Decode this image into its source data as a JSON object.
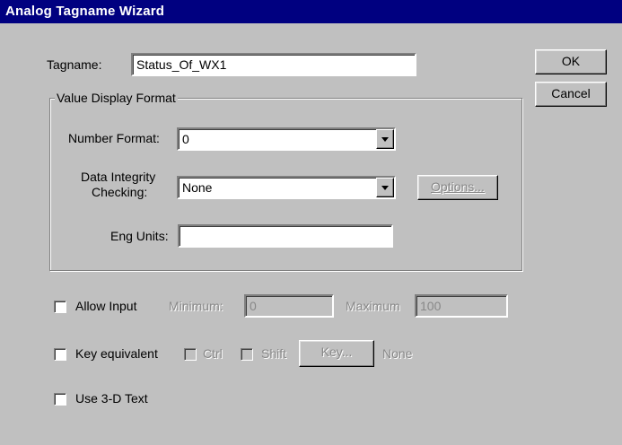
{
  "window": {
    "title": "Analog Tagname Wizard"
  },
  "tagname": {
    "label": "Tagname:",
    "value": "Status_Of_WX1"
  },
  "buttons": {
    "ok": "OK",
    "cancel": "Cancel",
    "options": "Options...",
    "key": "Key..."
  },
  "value_display": {
    "group_label": "Value Display Format",
    "number_format_label": "Number Format:",
    "number_format_value": "0",
    "integrity_label_line1": "Data Integrity",
    "integrity_label_line2": "Checking:",
    "integrity_value": "None",
    "eng_units_label": "Eng Units:",
    "eng_units_value": ""
  },
  "allow_input": {
    "label": "Allow Input",
    "checked": false,
    "minimum_label": "Minimum:",
    "minimum_value": "0",
    "maximum_label": "Maximum",
    "maximum_value": "100"
  },
  "key_equivalent": {
    "label": "Key equivalent",
    "checked": false,
    "ctrl_label": "Ctrl",
    "shift_label": "Shift",
    "key_value": "None"
  },
  "use_3d": {
    "label": "Use 3-D Text",
    "checked": false
  }
}
